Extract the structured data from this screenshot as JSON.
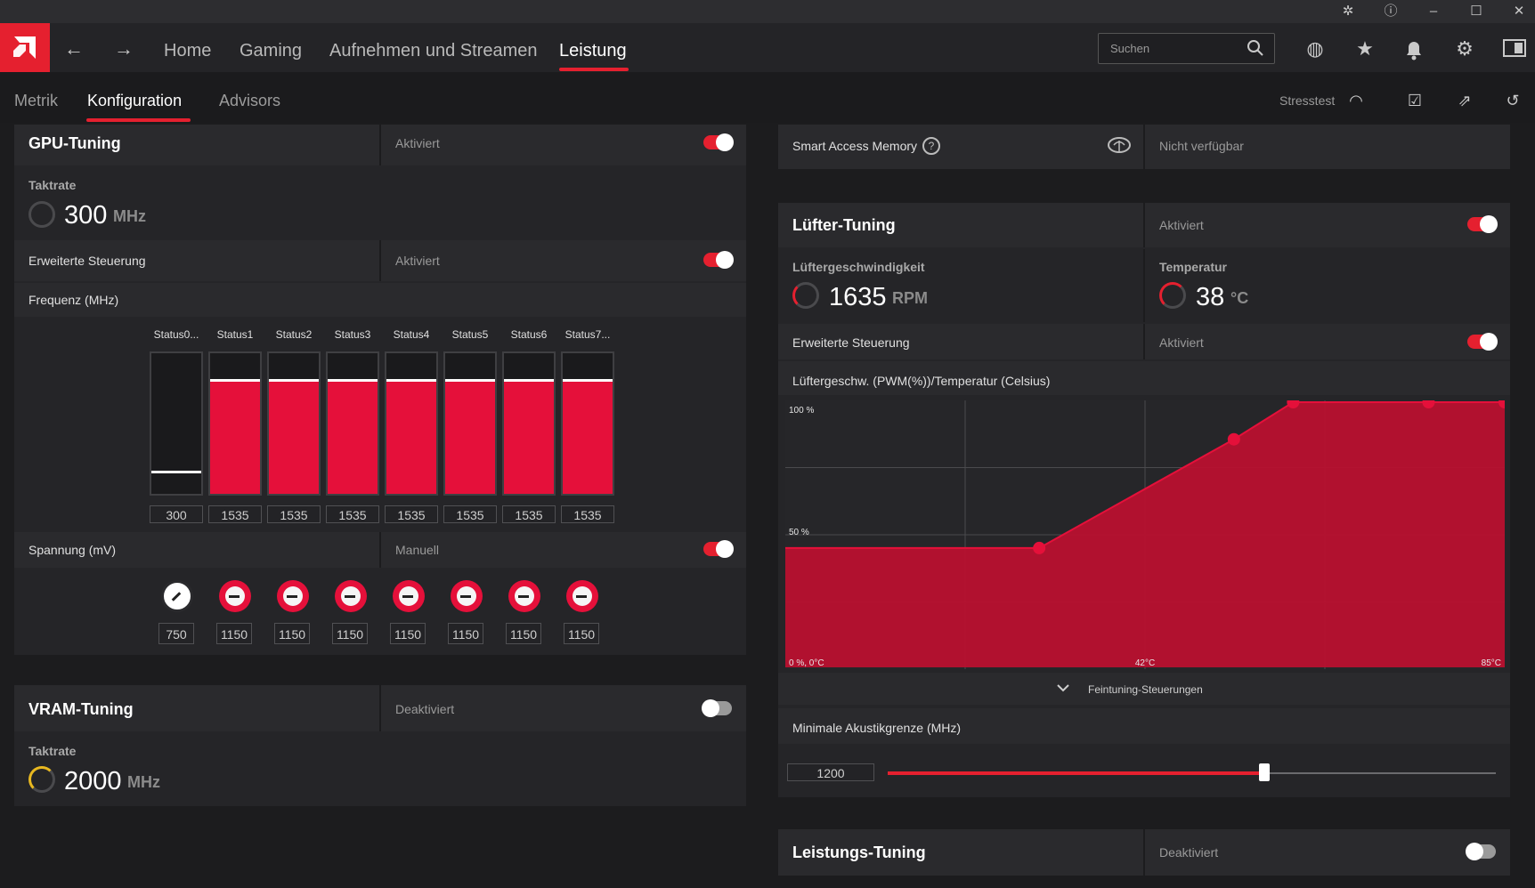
{
  "header": {
    "nav_tabs": [
      "Home",
      "Gaming",
      "Aufnehmen und Streamen",
      "Leistung"
    ],
    "active_tab": "Leistung",
    "search_placeholder": "Suchen"
  },
  "subnav": {
    "tabs": [
      "Metrik",
      "Konfiguration",
      "Advisors"
    ],
    "active_tab": "Konfiguration",
    "stress_label": "Stresstest"
  },
  "gpu_tuning": {
    "title": "GPU-Tuning",
    "status": "Aktiviert",
    "enabled": true,
    "clock_label": "Taktrate",
    "clock_value": "300",
    "clock_unit": "MHz",
    "advanced_label": "Erweiterte Steuerung",
    "advanced_status": "Aktiviert",
    "advanced_enabled": true,
    "freq_label": "Frequenz (MHz)",
    "states": [
      "Status0...",
      "Status1",
      "Status2",
      "Status3",
      "Status4",
      "Status5",
      "Status6",
      "Status7..."
    ],
    "freq_values": [
      "300",
      "1535",
      "1535",
      "1535",
      "1535",
      "1535",
      "1535",
      "1535"
    ],
    "voltage_label": "Spannung (mV)",
    "voltage_mode": "Manuell",
    "voltage_enabled": true,
    "voltage_values": [
      "750",
      "1150",
      "1150",
      "1150",
      "1150",
      "1150",
      "1150",
      "1150"
    ]
  },
  "vram_tuning": {
    "title": "VRAM-Tuning",
    "status": "Deaktiviert",
    "enabled": false,
    "clock_label": "Taktrate",
    "clock_value": "2000",
    "clock_unit": "MHz"
  },
  "sam": {
    "label": "Smart Access Memory",
    "status": "Nicht verfügbar"
  },
  "fan_tuning": {
    "title": "Lüfter-Tuning",
    "status": "Aktiviert",
    "enabled": true,
    "speed_label": "Lüftergeschwindigkeit",
    "speed_value": "1635",
    "speed_unit": "RPM",
    "temp_label": "Temperatur",
    "temp_value": "38",
    "temp_unit": "°C",
    "advanced_label": "Erweiterte Steuerung",
    "advanced_status": "Aktiviert",
    "advanced_enabled": true,
    "curve_label": "Lüftergeschw. (PWM(%))/Temperatur (Celsius)",
    "fine_tuning_label": "Feintuning-Steuerungen",
    "min_acoustic_label": "Minimale Akustikgrenze (MHz)",
    "min_acoustic_value": "1200",
    "min_acoustic_fraction": 0.62
  },
  "performance_tuning": {
    "title": "Leistungs-Tuning",
    "status": "Deaktiviert",
    "enabled": false
  },
  "chart_data": {
    "type": "area",
    "title": "Lüftergeschw. (PWM(%))/Temperatur (Celsius)",
    "x_unit": "°C",
    "y_unit": "%",
    "xlim": [
      0,
      85
    ],
    "ylim": [
      0,
      100
    ],
    "x_ticks": [
      "42°C",
      "85°C"
    ],
    "y_ticks": [
      "100 %",
      "50 %"
    ],
    "origin_label": "0 %, 0°C",
    "grid": true,
    "series": [
      {
        "x": [
          0,
          30,
          53,
          60,
          76,
          85
        ],
        "y": [
          45,
          45,
          86,
          100,
          100,
          100
        ]
      }
    ]
  },
  "colors": {
    "accent": "#e5202f",
    "fill": "#b8102f"
  }
}
